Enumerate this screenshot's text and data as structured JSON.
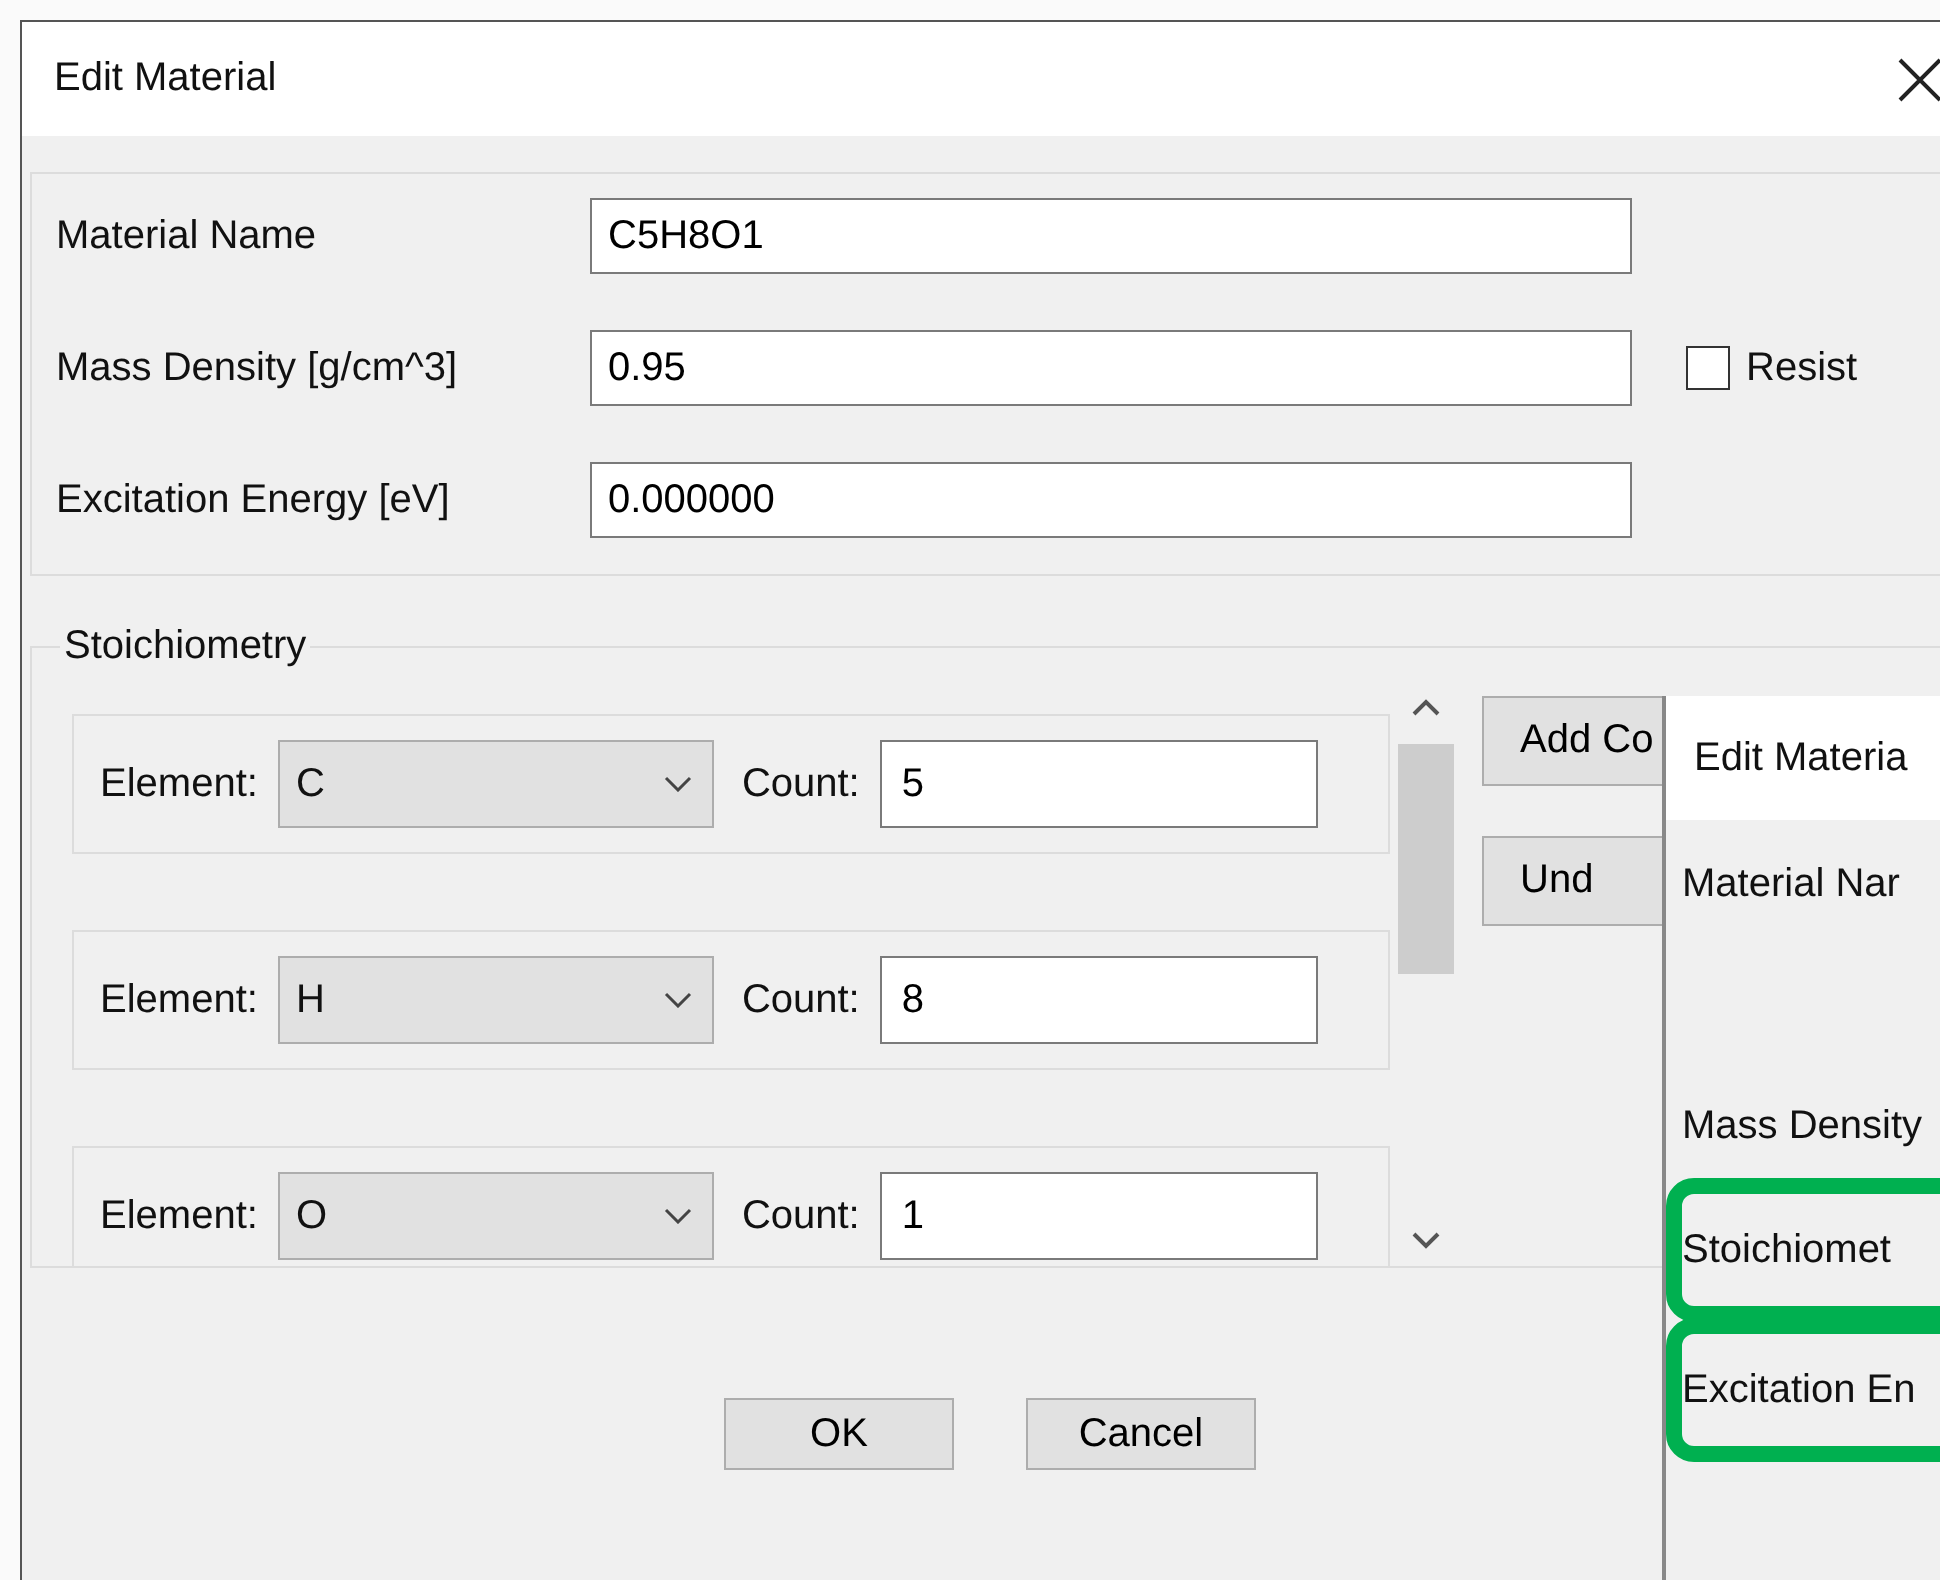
{
  "window": {
    "title": "Edit Material"
  },
  "fields": [
    {
      "label": "Material Name",
      "value": "C5H8O1"
    },
    {
      "label": "Mass Density [g/cm^3]",
      "value": "0.95"
    },
    {
      "label": "Excitation Energy [eV]",
      "value": "0.000000"
    }
  ],
  "resist": {
    "label": "Resist",
    "checked": false
  },
  "stoichiometry": {
    "title": "Stoichiometry",
    "rows": [
      {
        "element_label": "Element:",
        "element": "C",
        "count_label": "Count:",
        "count": "5"
      },
      {
        "element_label": "Element:",
        "element": "H",
        "count_label": "Count:",
        "count": "8"
      },
      {
        "element_label": "Element:",
        "element": "O",
        "count_label": "Count:",
        "count": "1"
      }
    ]
  },
  "side_buttons": [
    "Add Co",
    "Und"
  ],
  "buttons": [
    "OK",
    "Cancel"
  ],
  "overlay_window": {
    "title": "Edit Materia",
    "labels": [
      {
        "text": "Material Nar",
        "highlighted": false
      },
      {
        "text": "Mass Density",
        "highlighted": false
      },
      {
        "text": "Stoichiomet",
        "highlighted": true
      },
      {
        "text": "Excitation En",
        "highlighted": true
      }
    ]
  }
}
